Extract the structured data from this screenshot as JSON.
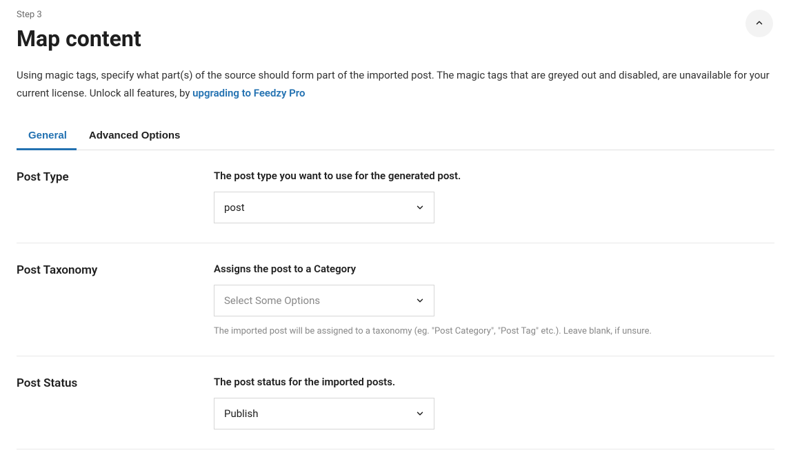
{
  "step_label": "Step 3",
  "page_title": "Map content",
  "description_pre": "Using magic tags, specify what part(s) of the source should form part of the imported post. The magic tags that are greyed out and disabled, are unavailable for your current license. Unlock all features, by ",
  "description_link": "upgrading to Feedzy Pro",
  "tabs": {
    "general": "General",
    "advanced": "Advanced Options"
  },
  "post_type": {
    "label": "Post Type",
    "desc": "The post type you want to use for the generated post.",
    "value": "post"
  },
  "post_taxonomy": {
    "label": "Post Taxonomy",
    "desc": "Assigns the post to a Category",
    "placeholder": "Select Some Options",
    "hint": "The imported post will be assigned to a taxonomy (eg. \"Post Category\", \"Post Tag\" etc.). Leave blank, if unsure."
  },
  "post_status": {
    "label": "Post Status",
    "desc": "The post status for the imported posts.",
    "value": "Publish"
  }
}
